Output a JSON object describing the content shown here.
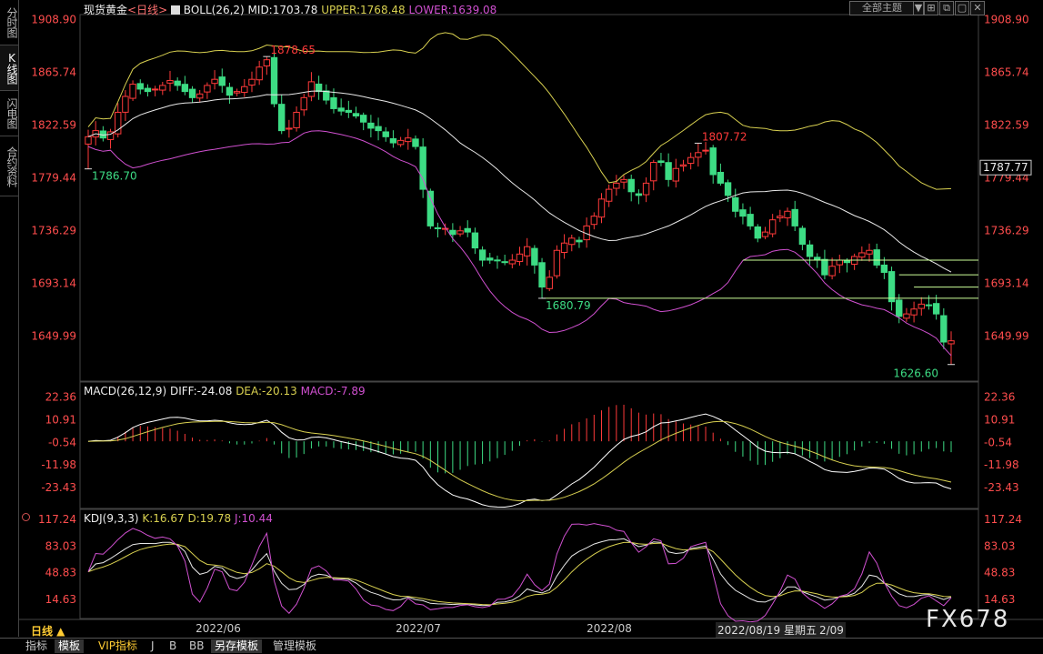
{
  "sidebar": [
    "分时图",
    "K线图",
    "闪电图",
    "合约资料"
  ],
  "sidebar_active": 1,
  "top_buttons": [
    "全部主题",
    "▼",
    "⊞",
    "⧉",
    "▢",
    "✕"
  ],
  "main_header": {
    "instrument": "现货黄金",
    "period": "<日线>",
    "boll": "BOLL(26,2)",
    "mid": "MID:1703.78",
    "upper": "UPPER:1768.48",
    "lower": "LOWER:1639.08"
  },
  "macd_header": {
    "name": "MACD(26,12,9)",
    "diff": "DIFF:-24.08",
    "dea": "DEA:-20.13",
    "macd": "MACD:-7.89"
  },
  "kdj_header": {
    "name": "KDJ(9,3,3)",
    "k": "K:16.67",
    "d": "D:19.78",
    "j": "J:10.44"
  },
  "current_price": "1787.77",
  "period_label": "日线 ▲",
  "crosshair_date": "2022/08/19 星期五",
  "date_tail": "2/09",
  "watermark": "FX678",
  "bottom_tabs": [
    "指标",
    "模板",
    "VIP指标",
    "J",
    "B",
    "BB",
    "另存模板",
    "管理模板"
  ],
  "bottom_active": 1,
  "colors": {
    "up": "#ff3a3a",
    "down": "#3ddc84",
    "upper": "#d8d050",
    "mid": "#e8e8e8",
    "lower": "#d050d0",
    "diff": "#ffffff",
    "dea": "#d8d050",
    "j": "#d050d0",
    "axis": "#ff4d4d",
    "grid": "#444444"
  },
  "chart_data": [
    {
      "type": "candlestick",
      "title": "现货黄金 <日线>",
      "y_ticks": [
        1908.9,
        1865.74,
        1822.59,
        1779.44,
        1736.29,
        1693.14,
        1649.99
      ],
      "ylim": [
        1613,
        1913
      ],
      "x_ticks": [
        "2022/06",
        "2022/07",
        "2022/08"
      ],
      "annotations": [
        {
          "label": "1878.65",
          "kind": "high"
        },
        {
          "label": "1786.70",
          "kind": "low"
        },
        {
          "label": "1807.72",
          "kind": "high"
        },
        {
          "label": "1680.79",
          "kind": "low"
        },
        {
          "label": "1626.60",
          "kind": "low"
        }
      ],
      "closes": [
        1813,
        1818,
        1812,
        1817,
        1833,
        1846,
        1856,
        1852,
        1850,
        1852,
        1855,
        1859,
        1855,
        1850,
        1845,
        1848,
        1855,
        1860,
        1855,
        1847,
        1850,
        1854,
        1860,
        1870,
        1876,
        1840,
        1818,
        1820,
        1833,
        1845,
        1858,
        1850,
        1843,
        1836,
        1834,
        1833,
        1830,
        1825,
        1820,
        1818,
        1813,
        1808,
        1810,
        1812,
        1805,
        1770,
        1740,
        1738,
        1738,
        1733,
        1736,
        1735,
        1722,
        1712,
        1712,
        1712,
        1710,
        1712,
        1717,
        1723,
        1708,
        1690,
        1698,
        1720,
        1726,
        1730,
        1727,
        1740,
        1748,
        1762,
        1770,
        1775,
        1778,
        1768,
        1765,
        1775,
        1792,
        1792,
        1778,
        1787,
        1790,
        1796,
        1800,
        1802,
        1782,
        1775,
        1765,
        1752,
        1748,
        1740,
        1730,
        1735,
        1745,
        1748,
        1752,
        1740,
        1725,
        1715,
        1712,
        1700,
        1707,
        1712,
        1710,
        1715,
        1718,
        1720,
        1708,
        1702,
        1678,
        1666,
        1668,
        1672,
        1676,
        1675,
        1668,
        1645,
        1646
      ],
      "bollinger": {
        "upper_last": 1768.48,
        "mid_last": 1703.78,
        "lower_last": 1639.08
      }
    },
    {
      "type": "bar+line",
      "title": "MACD(26,12,9)",
      "y_ticks": [
        22.36,
        10.91,
        -0.54,
        -11.98,
        -23.43
      ],
      "ylim": [
        -34,
        30
      ],
      "diff_last": -24.08,
      "dea_last": -20.13,
      "macd_last": -7.89
    },
    {
      "type": "line",
      "title": "KDJ(9,3,3)",
      "y_ticks": [
        117.24,
        83.03,
        48.83,
        14.63
      ],
      "ylim": [
        -10,
        130
      ],
      "k_last": 16.67,
      "d_last": 19.78,
      "j_last": 10.44
    }
  ]
}
